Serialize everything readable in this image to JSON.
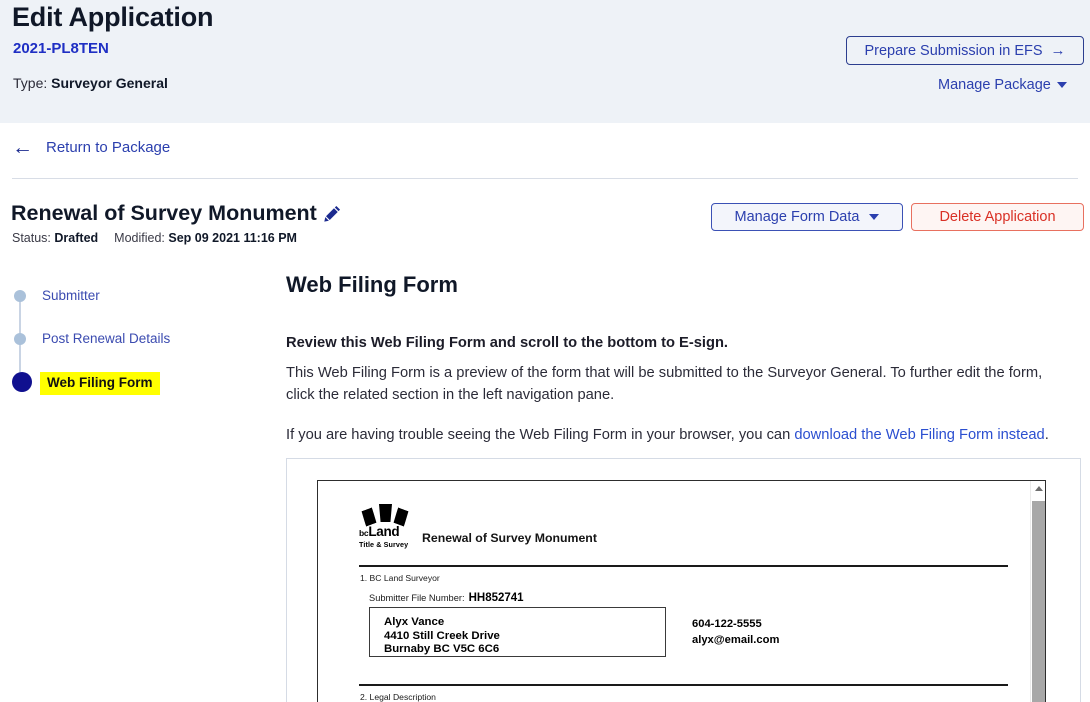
{
  "banner": {
    "title": "Edit Application",
    "package_number": "2021-PL8TEN",
    "type_label": "Type:",
    "type_value": "Surveyor General",
    "efs_button": "Prepare Submission in EFS",
    "efs_arrow": "→",
    "manage_package": "Manage Package"
  },
  "nav": {
    "back_arrow": "←",
    "return_label": "Return to Package"
  },
  "application": {
    "title": "Renewal of Survey Monument",
    "status_label": "Status:",
    "status_value": "Drafted",
    "modified_label": "Modified:",
    "modified_value": "Sep 09 2021 11:16 PM",
    "manage_form_data": "Manage Form Data",
    "delete_application": "Delete Application"
  },
  "stepper": {
    "items": [
      {
        "label": "Submitter",
        "active": false
      },
      {
        "label": "Post Renewal Details",
        "active": false
      },
      {
        "label": "Web Filing Form",
        "active": true
      }
    ]
  },
  "content": {
    "heading": "Web Filing Form",
    "instruction": "Review this Web Filing Form and scroll to the bottom to E-sign.",
    "paragraph": "This Web Filing Form is a preview of the form that will be submitted to the Surveyor General. To further edit the form, click the related section in the left navigation pane.",
    "trouble_prefix": "If you are having trouble seeing the Web Filing Form in your browser, you can ",
    "trouble_link": "download the Web Filing Form instead",
    "trouble_suffix": "."
  },
  "pdf_preview": {
    "logo": {
      "brand_bc": "bc",
      "brand_land": "Land",
      "tagline": "Title & Survey"
    },
    "form_title": "Renewal of Survey Monument",
    "section_1": "1. BC Land Surveyor",
    "file_number_label": "Submitter File Number:",
    "file_number_value": "HH852741",
    "address_line_1": "Alyx Vance",
    "address_line_2": "4410 Still Creek Drive",
    "address_line_3": "Burnaby BC V5C 6C6",
    "phone": "604-122-5555",
    "email": "alyx@email.com",
    "section_2": "2. Legal Description"
  },
  "colors": {
    "banner_bg": "#eef2f7",
    "link_blue": "#2b3fae",
    "accent_navy": "#10108f",
    "highlight_yellow": "#ffff00",
    "danger_red": "#d93025"
  }
}
